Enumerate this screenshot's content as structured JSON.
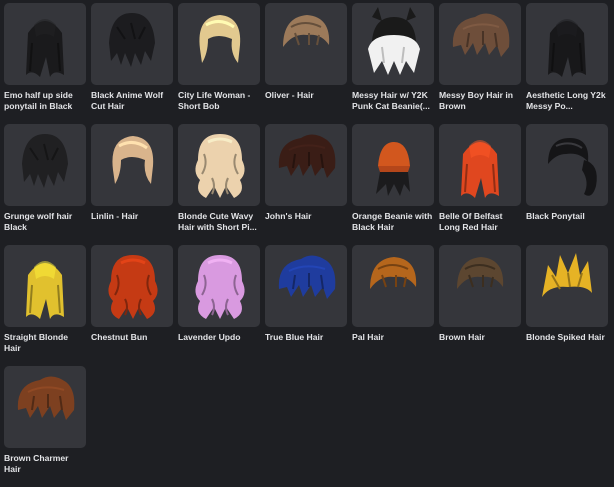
{
  "items": [
    {
      "name": "Emo half up side ponytail in Black",
      "icon": "hair-emo-black-icon",
      "color": "#1a1a1c",
      "style": "long"
    },
    {
      "name": "Black Anime Wolf Cut Hair",
      "icon": "hair-anime-wolf-black-icon",
      "color": "#1c1c1f",
      "style": "wolf"
    },
    {
      "name": "City Life Woman - Short Bob",
      "icon": "hair-blonde-bob-icon",
      "color": "#e2c98f",
      "style": "bob"
    },
    {
      "name": "Oliver - Hair",
      "icon": "hair-brown-short-icon",
      "color": "#9c7a5a",
      "style": "short"
    },
    {
      "name": "Messy Hair w/ Y2K Punk Cat Beanie(...",
      "icon": "hair-white-cat-beanie-icon",
      "color": "#f1f1f1",
      "style": "beanie"
    },
    {
      "name": "Messy Boy Hair in Brown",
      "icon": "hair-brown-messy-icon",
      "color": "#6e4e3a",
      "style": "messy"
    },
    {
      "name": "Aesthetic Long Y2k Messy Po...",
      "icon": "hair-black-long-ponytail-icon",
      "color": "#18181a",
      "style": "long"
    },
    {
      "name": "Grunge wolf hair Black",
      "icon": "hair-grunge-wolf-black-icon",
      "color": "#202022",
      "style": "wolf"
    },
    {
      "name": "Linlin - Hair",
      "icon": "hair-blonde-linlin-icon",
      "color": "#d9b48c",
      "style": "bob"
    },
    {
      "name": "Blonde Cute Wavy Hair with Short Pi...",
      "icon": "hair-blonde-wavy-icon",
      "color": "#ecd2ad",
      "style": "wavy"
    },
    {
      "name": "John's Hair",
      "icon": "hair-dark-brown-icon",
      "color": "#3a1d16",
      "style": "messy"
    },
    {
      "name": "Orange Beanie with Black Hair",
      "icon": "hair-orange-beanie-icon",
      "color": "#1b1b1d",
      "style": "beanie2"
    },
    {
      "name": "Belle Of Belfast Long Red Hair",
      "icon": "hair-red-long-icon",
      "color": "#e0471f",
      "style": "long"
    },
    {
      "name": "Black Ponytail",
      "icon": "hair-black-ponytail-icon",
      "color": "#151517",
      "style": "ponytail"
    },
    {
      "name": "Straight Blonde Hair",
      "icon": "hair-straight-blonde-icon",
      "color": "#e1c12e",
      "style": "long"
    },
    {
      "name": "Chestnut Bun",
      "icon": "hair-chestnut-bun-icon",
      "color": "#c53a14",
      "style": "wavy"
    },
    {
      "name": "Lavender Updo",
      "icon": "hair-lavender-updo-icon",
      "color": "#d99ae0",
      "style": "wavy"
    },
    {
      "name": "True Blue Hair",
      "icon": "hair-true-blue-icon",
      "color": "#1f3c9e",
      "style": "messy"
    },
    {
      "name": "Pal Hair",
      "icon": "hair-pal-brown-icon",
      "color": "#b5661c",
      "style": "short"
    },
    {
      "name": "Brown Hair",
      "icon": "hair-brown-icon",
      "color": "#5c4630",
      "style": "short"
    },
    {
      "name": "Blonde Spiked Hair",
      "icon": "hair-blonde-spiked-icon",
      "color": "#e6b325",
      "style": "spiked"
    },
    {
      "name": "Brown Charmer Hair",
      "icon": "hair-brown-charmer-icon",
      "color": "#7d4020",
      "style": "messy"
    }
  ]
}
